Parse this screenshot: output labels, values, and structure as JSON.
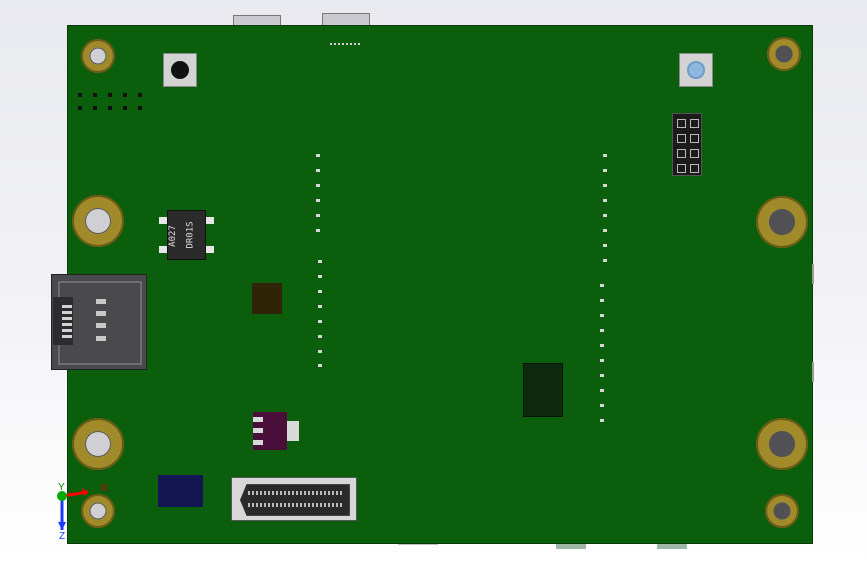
{
  "window": {
    "title": ""
  },
  "board": {
    "ic_marking_line1": "A027",
    "ic_marking_line2": "DR01S"
  },
  "axes": {
    "x_label": "X",
    "y_label": "Y",
    "z_label": "Z"
  },
  "colors": {
    "background": "#eceef2",
    "pcb": "#0b5e0b",
    "mounting_hole_ring": "#a08a2a",
    "chip_dark": "#2f2408",
    "chip_black": "#0d2a0d",
    "chip_purple": "#4a0e3a",
    "chip_navy": "#141652",
    "axis_x": "#ff0000",
    "axis_y": "#00aa00",
    "axis_z": "#1a3cff"
  },
  "icons": [
    "push-button-icon",
    "sd-card-slot-icon",
    "fpc-connector-icon",
    "pin-header-icon",
    "axis-triad-icon",
    "mounting-hole-icon"
  ]
}
